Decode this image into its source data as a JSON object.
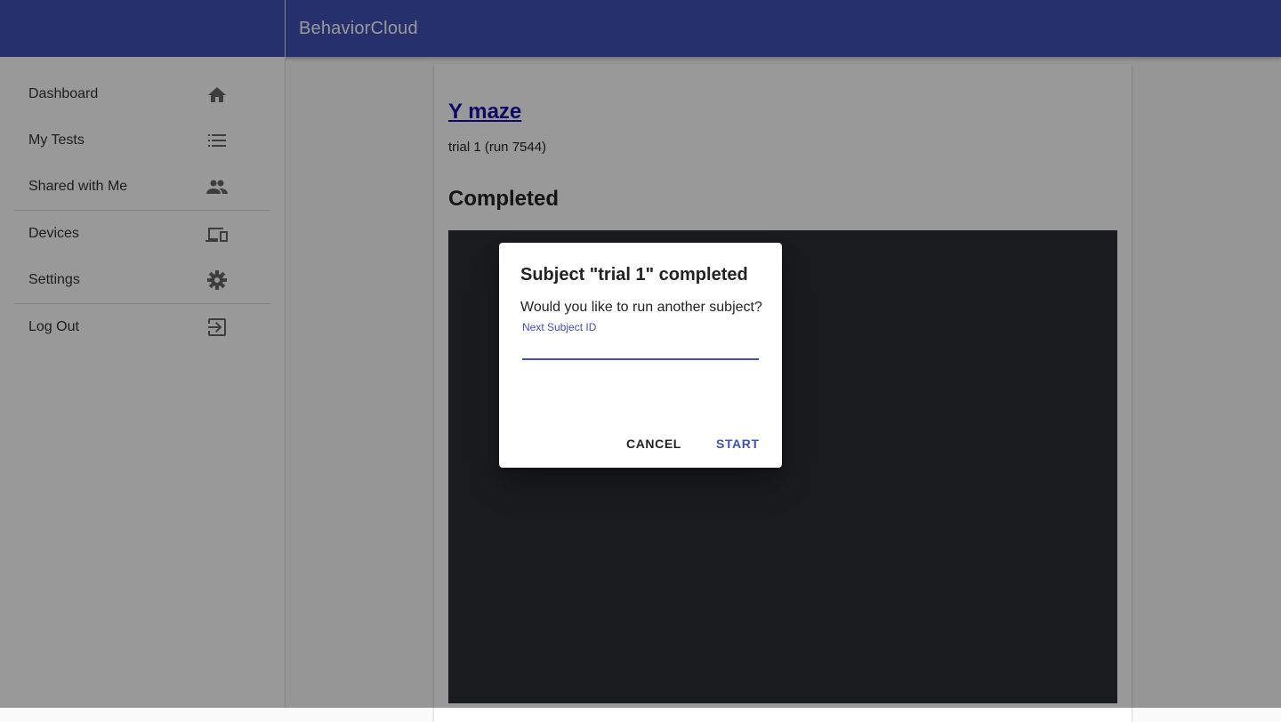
{
  "app": {
    "title": "BehaviorCloud"
  },
  "sidebar": {
    "items": [
      {
        "label": "Dashboard",
        "icon": "home-icon"
      },
      {
        "label": "My Tests",
        "icon": "list-icon"
      },
      {
        "label": "Shared with Me",
        "icon": "people-icon"
      },
      {
        "label": "Devices",
        "icon": "devices-icon"
      },
      {
        "label": "Settings",
        "icon": "gear-icon"
      },
      {
        "label": "Log Out",
        "icon": "logout-icon"
      }
    ]
  },
  "card": {
    "test_name": "Y maze",
    "run_info": "trial 1 (run 7544)",
    "status": "Completed"
  },
  "dialog": {
    "title": "Subject \"trial 1\" completed",
    "message": "Would you like to run another subject?",
    "field_label": "Next Subject ID",
    "field_value": "",
    "cancel_label": "CANCEL",
    "start_label": "START"
  },
  "colors": {
    "primary": "#3f51b5",
    "link": "#1a0dab"
  }
}
